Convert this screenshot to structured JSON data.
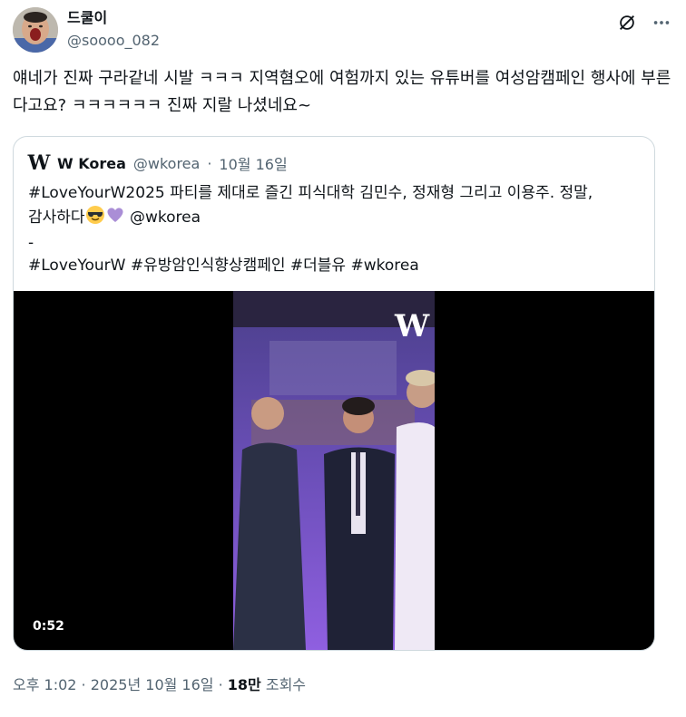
{
  "author": {
    "display_name": "드쿨이",
    "handle": "@soooo_082"
  },
  "tweet": {
    "text": "얘네가 진짜 구라같네 시발 ㅋㅋㅋ 지역혐오에 여험까지 있는 유튜버를 여성암캠페인 행사에 부른다고요? ㅋㅋㅋㅋㅋㅋ 진짜 지랄 나셨네요~"
  },
  "quote": {
    "logo": "W",
    "name": "W Korea",
    "handle": "@wkorea",
    "separator": "·",
    "date": "10월 16일",
    "line1": "#LoveYourW2025 파티를 제대로 즐긴 피식대학 김민수, 정재형 그리고 이용주. 정말,",
    "line2_text": "감사하다",
    "line2_mention": " @wkorea",
    "line3": "-",
    "line4": "#LoveYourW #유방암인식향상캠페인 #더블유 #wkorea",
    "video": {
      "duration": "0:52",
      "watermark": "W"
    }
  },
  "meta": {
    "time": "오후 1:02",
    "sep1": " · ",
    "date": "2025년 10월 16일",
    "sep2": " · ",
    "views_count": "18만",
    "views_label": " 조회수"
  },
  "icons": {
    "grok": "grok-icon",
    "more": "more-icon",
    "emoji1": "sunglasses-emoji-icon",
    "emoji2": "purple-heart-emoji-icon"
  },
  "colors": {
    "text": "#0f1419",
    "secondary": "#536471",
    "border": "#cfd9de",
    "video_bg": "#000000"
  }
}
